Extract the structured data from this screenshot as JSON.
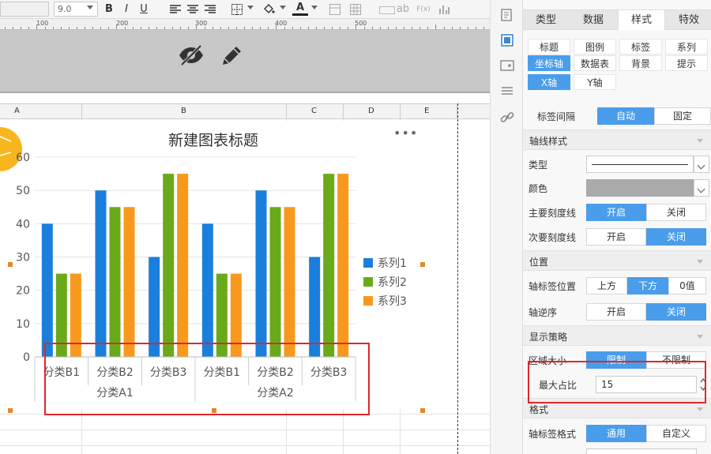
{
  "toolbar": {
    "font_size_value": "9.0",
    "bold_label": "B",
    "italic_label": "I",
    "underline_label": "U",
    "font_color_label": "A",
    "ab_label": "ab",
    "fx_label": "F(x)"
  },
  "ruler": {
    "marks": [
      "100",
      "200",
      "300",
      "400",
      "500"
    ]
  },
  "columns": [
    "A",
    "B",
    "C",
    "D",
    "E"
  ],
  "chart_data": {
    "type": "bar",
    "title": "新建图表标题",
    "categories": [
      "分类B1",
      "分类B2",
      "分类B3",
      "分类B1",
      "分类B2",
      "分类B3"
    ],
    "groups": [
      "分类A1",
      "分类A2"
    ],
    "series": [
      {
        "name": "系列1",
        "color": "#1a7fdc",
        "values": [
          40,
          50,
          30,
          40,
          50,
          30
        ]
      },
      {
        "name": "系列2",
        "color": "#6aaa1a",
        "values": [
          25,
          45,
          55,
          25,
          45,
          55
        ]
      },
      {
        "name": "系列3",
        "color": "#f8991d",
        "values": [
          25,
          45,
          55,
          25,
          45,
          55
        ]
      }
    ],
    "yticks": [
      "0",
      "10",
      "20",
      "30",
      "40",
      "50",
      "60"
    ],
    "ylim": [
      0,
      60
    ],
    "legend_position": "right",
    "more_label": "•••"
  },
  "panel": {
    "top_tabs": [
      "类型",
      "数据",
      "样式",
      "特效"
    ],
    "active_top_tab": 2,
    "sub_tabs": [
      "标题",
      "图例",
      "标签",
      "系列",
      "坐标轴",
      "数据表",
      "背景",
      "提示"
    ],
    "axis_tabs": [
      "X轴",
      "Y轴"
    ],
    "label_interval": {
      "label": "标签间隔",
      "options": [
        "自动",
        "固定"
      ]
    },
    "axis_line_section": "轴线样式",
    "type_label": "类型",
    "color_label": "颜色",
    "line_color": "#aaaaaa",
    "major_tick": {
      "label": "主要刻度线",
      "options": [
        "开启",
        "关闭"
      ]
    },
    "minor_tick": {
      "label": "次要刻度线",
      "options": [
        "开启",
        "关闭"
      ]
    },
    "position_section": "位置",
    "label_pos": {
      "label": "轴标签位置",
      "options": [
        "上方",
        "下方",
        "0值"
      ]
    },
    "reverse": {
      "label": "轴逆序",
      "options": [
        "开启",
        "关闭"
      ]
    },
    "display_section": "显示策略",
    "area_size": {
      "label": "区域大小",
      "options": [
        "限制",
        "不限制"
      ]
    },
    "max_ratio": {
      "label": "最大占比",
      "value": "15"
    },
    "format_section": "格式",
    "label_format": {
      "label": "轴标签格式",
      "options": [
        "通用",
        "自定义"
      ]
    }
  }
}
